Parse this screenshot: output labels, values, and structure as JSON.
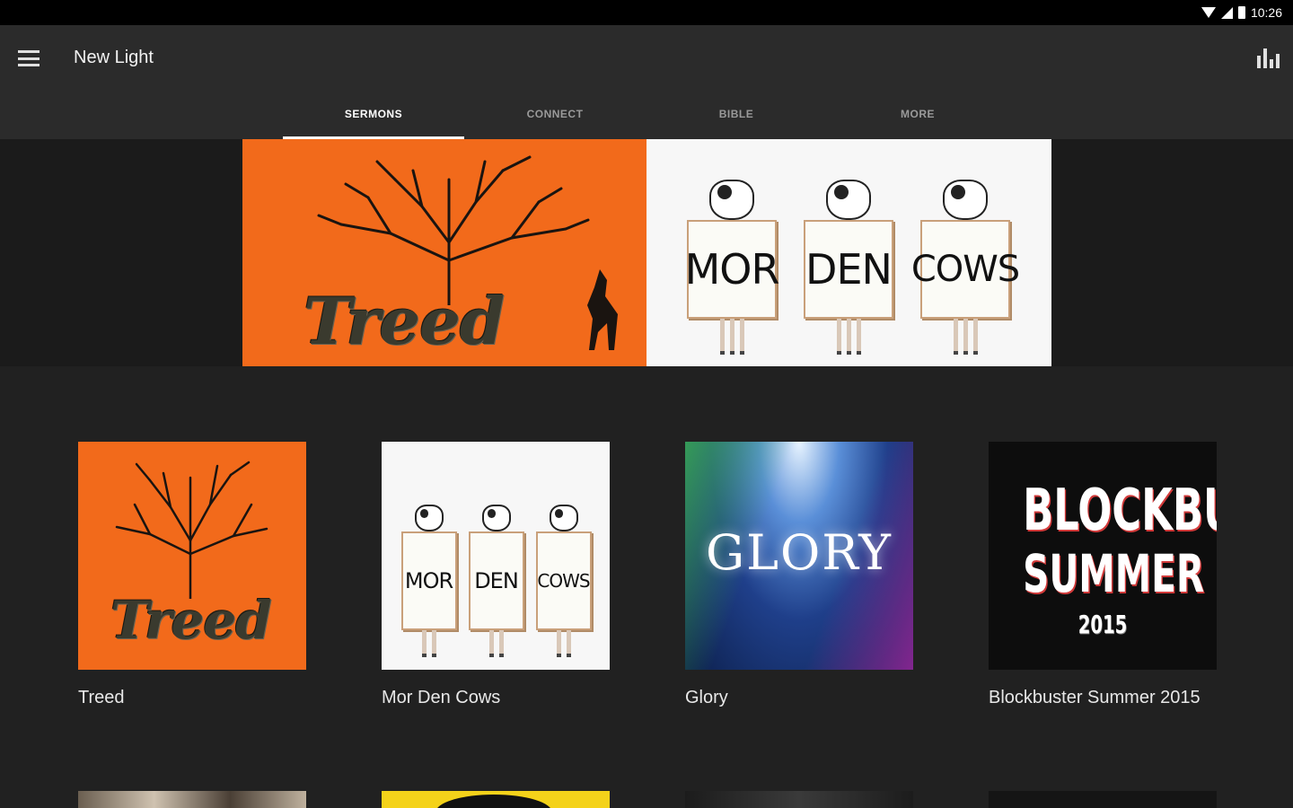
{
  "status_bar": {
    "time": "10:26"
  },
  "app_bar": {
    "title": "New Light"
  },
  "tabs": [
    {
      "label": "SERMONS",
      "active": true
    },
    {
      "label": "CONNECT",
      "active": false
    },
    {
      "label": "BIBLE",
      "active": false
    },
    {
      "label": "MORE",
      "active": false
    }
  ],
  "banner": {
    "slides": [
      {
        "word": "Treed"
      },
      {
        "signs": [
          "MOR",
          "DEN",
          "COWS"
        ]
      }
    ]
  },
  "sermons": [
    {
      "title": "Treed",
      "art_word": "Treed"
    },
    {
      "title": "Mor Den Cows",
      "signs": [
        "MOR",
        "DEN",
        "COWS"
      ]
    },
    {
      "title": "Glory",
      "art_word": "GLORY"
    },
    {
      "title": "Blockbuster Summer 2015",
      "art_lines": [
        "BLOCKBUSTER",
        "SUMMER",
        "2015"
      ]
    }
  ],
  "icons": {
    "menu": "hamburger-menu-icon",
    "stats": "bar-chart-icon",
    "wifi": "wifi-icon",
    "signal": "cell-signal-icon",
    "battery": "battery-icon"
  },
  "colors": {
    "app_bar": "#2b2b2b",
    "background": "#212121",
    "orange_art": "#f26a1b",
    "tab_indicator": "#ffffff"
  }
}
